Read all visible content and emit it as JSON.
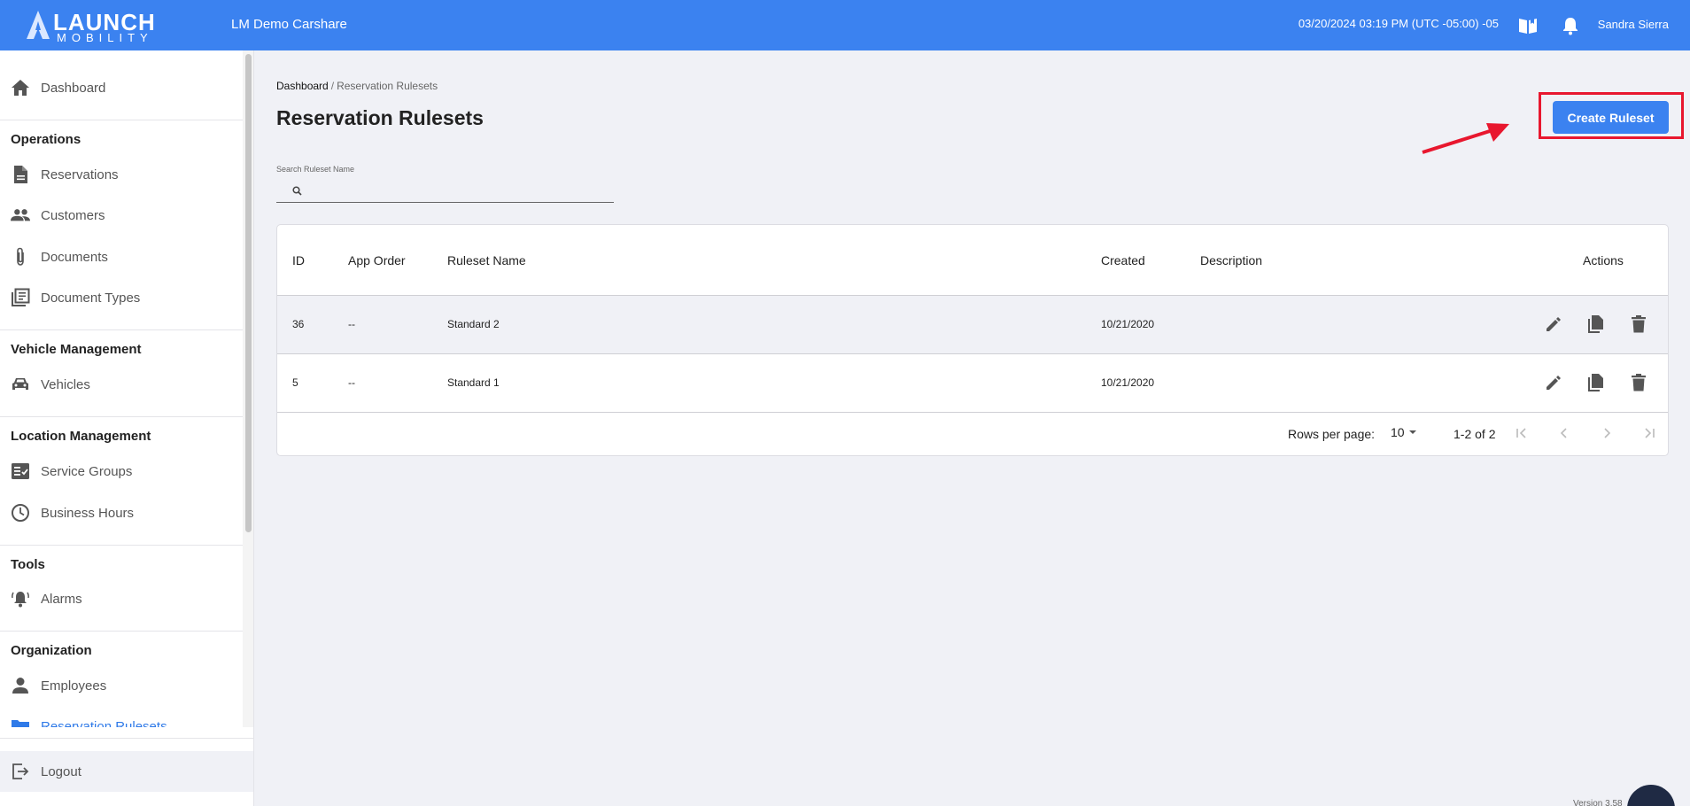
{
  "topbar": {
    "logo_main": "LAUNCH",
    "logo_sub": "MOBILITY",
    "org_name": "LM Demo Carshare",
    "datetime": "03/20/2024 03:19 PM (UTC -05:00) -05",
    "user_name": "Sandra Sierra",
    "icons": [
      "book-icon",
      "bell-icon"
    ]
  },
  "sidebar": {
    "dashboard": "Dashboard",
    "sections": {
      "operations": "Operations",
      "vehicle_management": "Vehicle Management",
      "location_management": "Location Management",
      "tools": "Tools",
      "organization": "Organization"
    },
    "items": {
      "reservations": "Reservations",
      "customers": "Customers",
      "documents": "Documents",
      "document_types": "Document Types",
      "vehicles": "Vehicles",
      "service_groups": "Service Groups",
      "business_hours": "Business Hours",
      "alarms": "Alarms",
      "employees": "Employees",
      "reservation_rulesets": "Reservation Rulesets"
    },
    "logout": "Logout",
    "accent_color": "#2f7ae8"
  },
  "main": {
    "breadcrumb": {
      "home": "Dashboard",
      "separator": "/",
      "current": "Reservation Rulesets"
    },
    "title": "Reservation Rulesets",
    "create_button": "Create Ruleset",
    "search": {
      "label": "Search Ruleset Name",
      "value": "",
      "placeholder": ""
    },
    "table": {
      "headers": [
        "ID",
        "App Order",
        "Ruleset Name",
        "Created",
        "Description",
        "Actions"
      ],
      "rows": [
        {
          "id": "36",
          "app_order": "--",
          "name": "Standard 2",
          "created": "10/21/2020",
          "description": ""
        },
        {
          "id": "5",
          "app_order": "--",
          "name": "Standard 1",
          "created": "10/21/2020",
          "description": ""
        }
      ],
      "row_actions": [
        "edit-icon",
        "copy-icon",
        "delete-icon"
      ]
    },
    "pagination": {
      "rows_per_page_label": "Rows per page:",
      "rows_per_page": "10",
      "range": "1-2 of 2"
    }
  },
  "footer": {
    "version": "Version 3.58"
  },
  "colors": {
    "primary": "#3b82f0",
    "highlight": "#e8172e",
    "background": "#f0f1f6"
  }
}
